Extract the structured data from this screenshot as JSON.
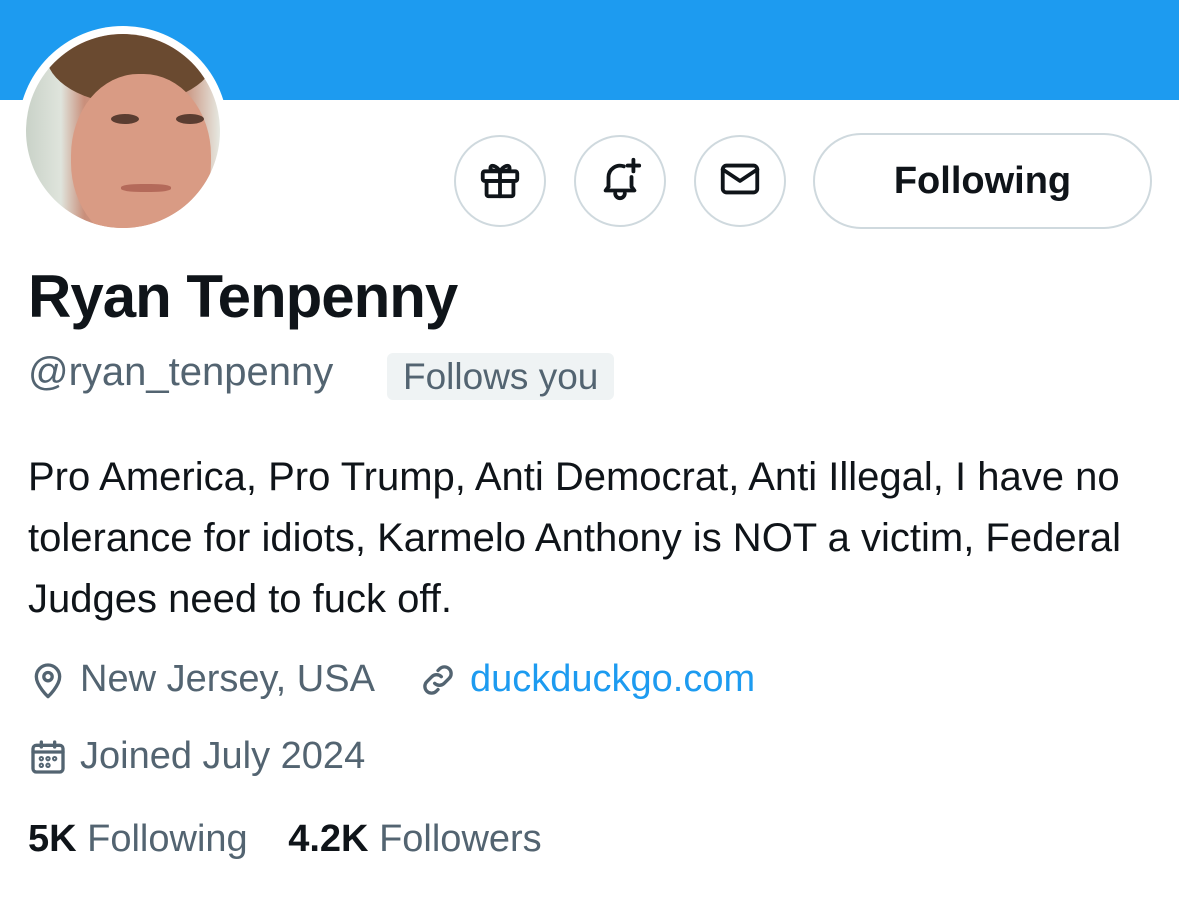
{
  "profile": {
    "name": "Ryan Tenpenny",
    "handle": "@ryan_tenpenny",
    "follows_you": "Follows you",
    "bio": "Pro America, Pro Trump, Anti Democrat, Anti Illegal, I have no tolerance for idiots, Karmelo Anthony is NOT a victim, Federal Judges need to fuck off.",
    "location": "New Jersey, USA",
    "website": "duckduckgo.com",
    "joined": "Joined July 2024",
    "following_count": "5K",
    "following_label": "Following",
    "followers_count": "4.2K",
    "followers_label": "Followers"
  },
  "actions": {
    "follow_button": "Following",
    "gift_icon": "gift-icon",
    "notify_icon": "bell-plus-icon",
    "message_icon": "envelope-icon"
  },
  "colors": {
    "banner": "#1d9bf0",
    "link": "#1d9bf0",
    "secondary_text": "#536471",
    "primary_text": "#0f1419"
  }
}
